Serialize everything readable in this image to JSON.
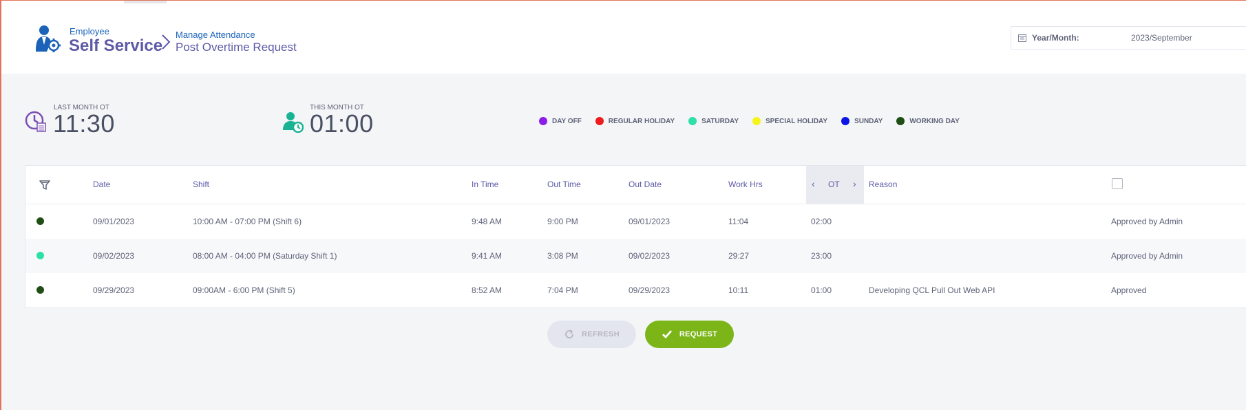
{
  "header": {
    "brand_small": "Employee",
    "brand_big": "Self Service",
    "crumb_parent": "Manage Attendance",
    "crumb_current": "Post Overtime Request",
    "year_month_label": "Year/Month:",
    "year_month_value": "2023/September"
  },
  "stats": {
    "last_month_label": "LAST MONTH OT",
    "last_month_value": "11:30",
    "this_month_label": "THIS MONTH OT",
    "this_month_value": "01:00"
  },
  "legend": [
    {
      "label": "DAY OFF",
      "color": "#8a1ee8"
    },
    {
      "label": "REGULAR HOLIDAY",
      "color": "#ee1c1c"
    },
    {
      "label": "SATURDAY",
      "color": "#2ee0a6"
    },
    {
      "label": "SPECIAL HOLIDAY",
      "color": "#f5f51c"
    },
    {
      "label": "SUNDAY",
      "color": "#0d14e6"
    },
    {
      "label": "WORKING DAY",
      "color": "#1f4d16"
    }
  ],
  "table": {
    "columns": {
      "date": "Date",
      "shift": "Shift",
      "in_time": "In Time",
      "out_time": "Out Time",
      "out_date": "Out Date",
      "work_hrs": "Work Hrs",
      "ot": "OT",
      "reason": "Reason"
    },
    "rows": [
      {
        "dot_color": "#1f4d16",
        "date": "09/01/2023",
        "shift": "10:00 AM - 07:00 PM (Shift 6)",
        "in_time": "9:48 AM",
        "out_time": "9:00 PM",
        "out_date": "09/01/2023",
        "work_hrs": "11:04",
        "ot": "02:00",
        "reason": "",
        "status": "Approved by Admin"
      },
      {
        "dot_color": "#2ee0a6",
        "date": "09/02/2023",
        "shift": "08:00 AM - 04:00 PM (Saturday Shift 1)",
        "in_time": "9:41 AM",
        "out_time": "3:08 PM",
        "out_date": "09/02/2023",
        "work_hrs": "29:27",
        "ot": "23:00",
        "reason": "",
        "status": "Approved by Admin"
      },
      {
        "dot_color": "#1f4d16",
        "date": "09/29/2023",
        "shift": "09:00AM - 6:00 PM (Shift 5)",
        "in_time": "8:52 AM",
        "out_time": "7:04 PM",
        "out_date": "09/29/2023",
        "work_hrs": "10:11",
        "ot": "01:00",
        "reason": "Developing QCL Pull Out Web API",
        "status": "Approved"
      }
    ]
  },
  "buttons": {
    "refresh": "REFRESH",
    "request": "REQUEST"
  }
}
